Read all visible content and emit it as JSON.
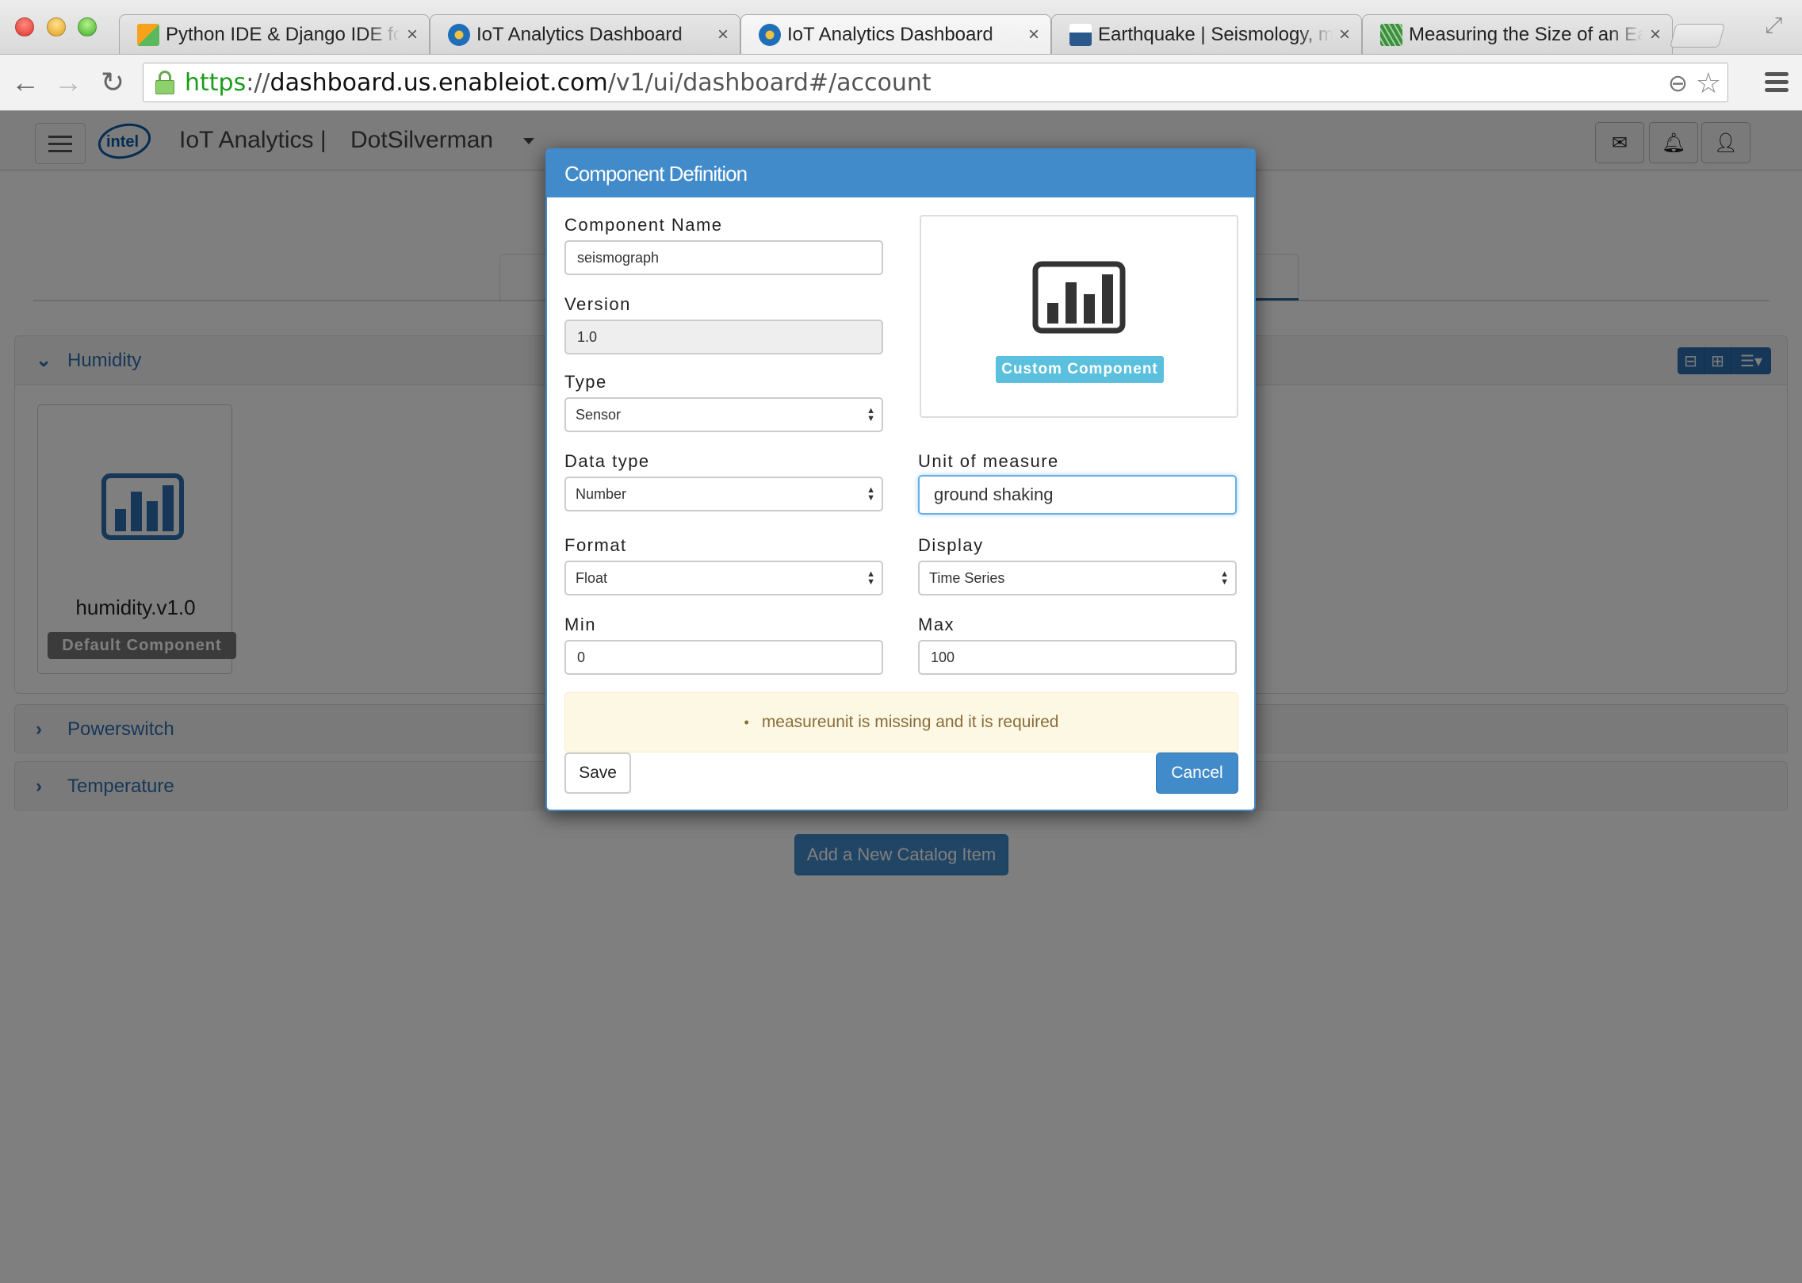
{
  "browser": {
    "tabs": [
      {
        "title": "Python IDE & Django IDE for Web developers",
        "favicon": "pycharm-icon",
        "active": false
      },
      {
        "title": "IoT Analytics Dashboard",
        "favicon": "iot-dashboard-icon",
        "active": false
      },
      {
        "title": "IoT Analytics Dashboard",
        "favicon": "iot-dashboard-icon",
        "active": true
      },
      {
        "title": "Earthquake | Seismology, measurement",
        "favicon": "earthquake-site-icon",
        "active": false
      },
      {
        "title": "Measuring the Size of an Earthquake",
        "favicon": "seismogram-icon",
        "active": false
      }
    ],
    "url": {
      "scheme": "https",
      "separator": "://",
      "host": "dashboard.us.enableiot.com",
      "path": "/v1/ui/dashboard#/account"
    }
  },
  "app": {
    "brand": "IoT Analytics |",
    "account": "DotSilverman",
    "header_buttons": [
      "mail-icon",
      "bell-icon",
      "user-icon"
    ],
    "catalog": {
      "panels": [
        {
          "title": "Humidity",
          "expanded": true,
          "components": [
            {
              "name": "humidity.v1.0",
              "badge": "Default Component"
            }
          ]
        },
        {
          "title": "Powerswitch",
          "expanded": false
        },
        {
          "title": "Temperature",
          "expanded": false
        }
      ],
      "add_button": "Add a New Catalog Item"
    }
  },
  "modal": {
    "title": "Component Definition",
    "fields": {
      "component_name": {
        "label": "Component Name",
        "value": "seismograph"
      },
      "version": {
        "label": "Version",
        "value": "1.0"
      },
      "type": {
        "label": "Type",
        "value": "Sensor"
      },
      "data_type": {
        "label": "Data type",
        "value": "Number"
      },
      "unit_of_measure": {
        "label": "Unit of measure",
        "value": "ground shaking"
      },
      "format": {
        "label": "Format",
        "value": "Float"
      },
      "display": {
        "label": "Display",
        "value": "Time Series"
      },
      "min": {
        "label": "Min",
        "value": "0"
      },
      "max": {
        "label": "Max",
        "value": "100"
      }
    },
    "preview_badge": "Custom Component",
    "error": "measureunit is missing and it is required",
    "save_label": "Save",
    "cancel_label": "Cancel"
  },
  "colors": {
    "primary": "#428bca",
    "info_badge": "#5bc0de",
    "warning_bg": "#fcf8e3",
    "warning_text": "#8a6d3b"
  }
}
